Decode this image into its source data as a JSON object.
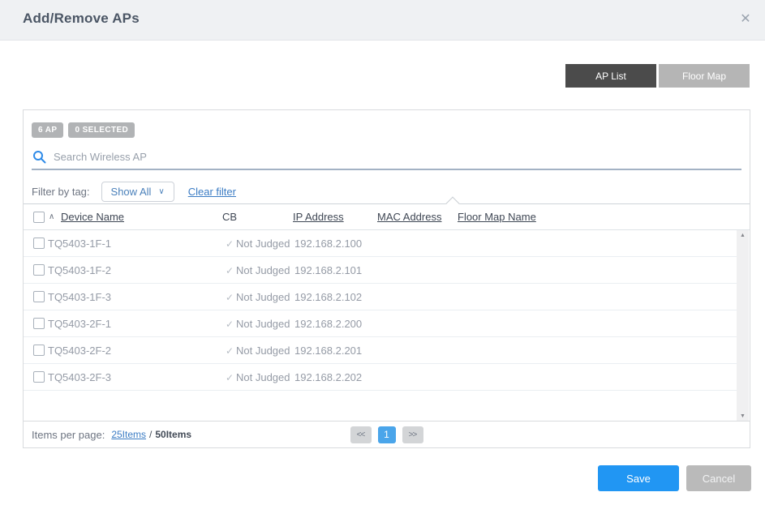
{
  "dialog": {
    "title": "Add/Remove APs"
  },
  "icons": {
    "close": "✕",
    "chevron_down": "∨",
    "sort_asc": "∧",
    "check": "✓",
    "scroll_up": "▲",
    "scroll_down": "▼"
  },
  "tabs": [
    {
      "label": "AP List",
      "active": true
    },
    {
      "label": "Floor Map",
      "active": false
    }
  ],
  "summary": {
    "ap_count_badge": "6 AP",
    "selected_badge": "0 SELECTED"
  },
  "search": {
    "placeholder": "Search Wireless AP"
  },
  "filter": {
    "label": "Filter by tag:",
    "selected_option": "Show All",
    "clear_link": "Clear filter"
  },
  "table": {
    "columns": {
      "device_name": "Device Name",
      "cb": "CB",
      "ip_address": "IP Address",
      "mac_address": "MAC Address",
      "floor_map_name": "Floor Map Name"
    },
    "rows": [
      {
        "device_name": "TQ5403-1F-1",
        "cb_status": "Not Judged",
        "ip_address": "192.168.2.100"
      },
      {
        "device_name": "TQ5403-1F-2",
        "cb_status": "Not Judged",
        "ip_address": "192.168.2.101"
      },
      {
        "device_name": "TQ5403-1F-3",
        "cb_status": "Not Judged",
        "ip_address": "192.168.2.102"
      },
      {
        "device_name": "TQ5403-2F-1",
        "cb_status": "Not Judged",
        "ip_address": "192.168.2.200"
      },
      {
        "device_name": "TQ5403-2F-2",
        "cb_status": "Not Judged",
        "ip_address": "192.168.2.201"
      },
      {
        "device_name": "TQ5403-2F-3",
        "cb_status": "Not Judged",
        "ip_address": "192.168.2.202"
      }
    ]
  },
  "pagination": {
    "items_per_page_label": "Items per page:",
    "page_size_link": "25Items",
    "separator": "/",
    "total_label": "50Items",
    "prev": "<<",
    "current_page": "1",
    "next": ">>"
  },
  "actions": {
    "save": "Save",
    "cancel": "Cancel"
  },
  "colors": {
    "accent_blue": "#2196f3",
    "link_blue": "#3b7cc4",
    "tab_active": "#4b4b4b",
    "tab_inactive": "#b5b5b5",
    "badge_gray": "#b1b3b5",
    "current_page_blue": "#4aa5ea",
    "cancel_gray": "#bababa",
    "header_bg": "#eff1f3"
  }
}
